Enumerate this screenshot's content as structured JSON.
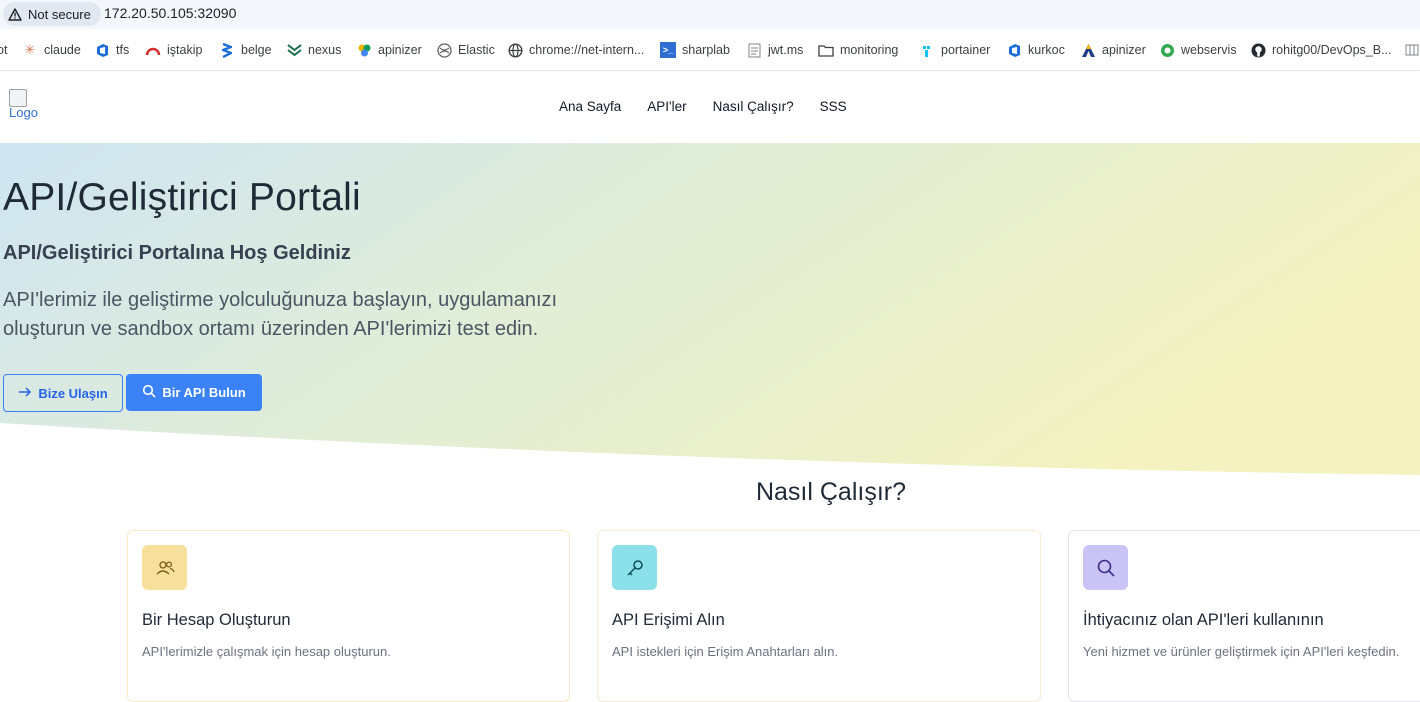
{
  "browser": {
    "security_label": "Not secure",
    "url": "172.20.50.105:32090"
  },
  "bookmarks": [
    {
      "label": "ot",
      "icon": "bookmark-partial"
    },
    {
      "label": "claude",
      "icon": "claude-icon"
    },
    {
      "label": "tfs",
      "icon": "azure-devops-icon"
    },
    {
      "label": "iştakip",
      "icon": "gauge-icon"
    },
    {
      "label": "belge",
      "icon": "belge-icon"
    },
    {
      "label": "nexus",
      "icon": "nexus-icon"
    },
    {
      "label": "apinizer",
      "icon": "apinizer-icon"
    },
    {
      "label": "Elastic",
      "icon": "elastic-icon"
    },
    {
      "label": "chrome://net-intern...",
      "icon": "globe-icon"
    },
    {
      "label": "sharplab",
      "icon": "sharplab-icon"
    },
    {
      "label": "jwt.ms",
      "icon": "document-icon"
    },
    {
      "label": "monitoring",
      "icon": "folder-icon"
    },
    {
      "label": "portainer",
      "icon": "portainer-icon"
    },
    {
      "label": "kurkoc",
      "icon": "azure-devops-icon"
    },
    {
      "label": "apinizer",
      "icon": "apinizer-a-icon"
    },
    {
      "label": "webservis",
      "icon": "webservis-icon"
    },
    {
      "label": "rohitg00/DevOps_B...",
      "icon": "github-icon"
    }
  ],
  "site": {
    "logo_alt": "Logo",
    "nav": [
      "Ana Sayfa",
      "API'ler",
      "Nasıl Çalışır?",
      "SSS"
    ]
  },
  "hero": {
    "title": "API/Geliştirici Portali",
    "subtitle": "API/Geliştirici Portalına Hoş Geldiniz",
    "description": "API'lerimiz ile geliştirme yolculuğunuza başlayın, uygulamanızı oluşturun ve sandbox ortamı üzerinden API'lerimizi test edin.",
    "contact_button": "Bize Ulaşın",
    "find_button": "Bir API Bulun"
  },
  "how": {
    "title": "Nasıl Çalışır?",
    "cards": [
      {
        "title": "Bir Hesap Oluşturun",
        "description": "API'lerimizle çalışmak için hesap oluşturun.",
        "icon": "users-icon",
        "color": "#f7df9c"
      },
      {
        "title": "API Erişimi Alın",
        "description": "API istekleri için Erişim Anahtarları alın.",
        "icon": "key-icon",
        "color": "#8be0ea"
      },
      {
        "title": "İhtiyacınız olan API'leri kullanının",
        "description": "Yeni hizmet ve ürünler geliştirmek için API'leri keşfedin.",
        "icon": "search-icon",
        "color": "#c9c4f5"
      }
    ]
  }
}
